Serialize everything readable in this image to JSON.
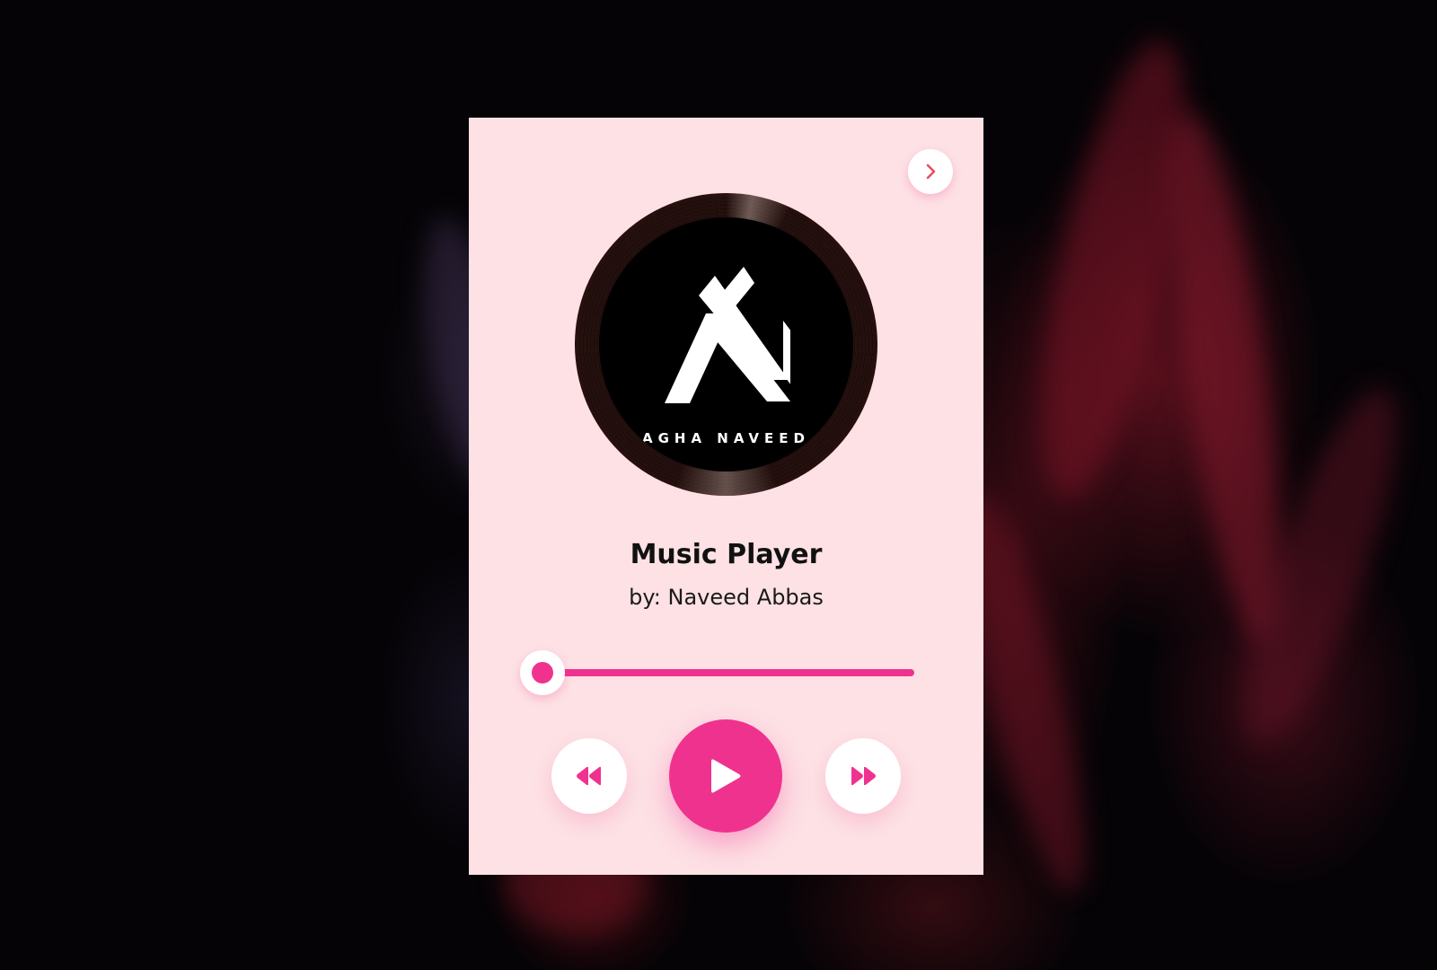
{
  "player": {
    "album_art_text": "AGHA NAVEED",
    "title": "Music Player",
    "artist": "by: Naveed Abbas",
    "progress_fraction": 0.0
  },
  "icons": {
    "next_track": "chevron-right-icon",
    "rewind": "rewind-icon",
    "play": "play-icon",
    "forward": "fast-forward-icon"
  },
  "colors": {
    "accent": "#f0328f",
    "card_background": "#fde1e5",
    "chevron": "#e8505b"
  }
}
